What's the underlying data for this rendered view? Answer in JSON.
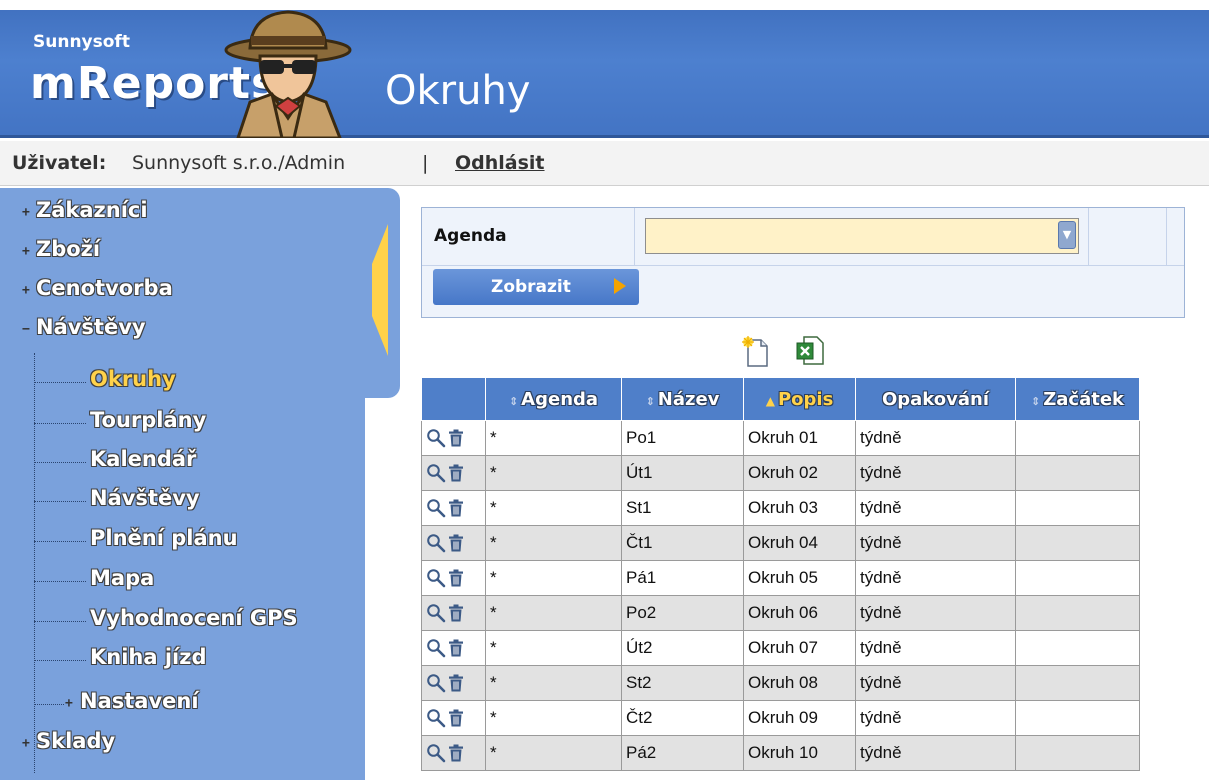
{
  "header": {
    "brand_small": "Sunnysoft",
    "brand_big": "mReports",
    "page_title": "Okruhy"
  },
  "userbar": {
    "user_label": "Uživatel:",
    "user_name": "Sunnysoft s.r.o./Admin",
    "separator": "|",
    "logout": "Odhlásit"
  },
  "sidebar": {
    "items": [
      {
        "label": "Zákazníci",
        "sign": "+"
      },
      {
        "label": "Zboží",
        "sign": "+"
      },
      {
        "label": "Cenotvorba",
        "sign": "+"
      },
      {
        "label": "Návštěvy",
        "sign": "−"
      }
    ],
    "subitems": [
      {
        "label": "Okruhy",
        "active": true
      },
      {
        "label": "Tourplány"
      },
      {
        "label": "Kalendář"
      },
      {
        "label": "Návštěvy"
      },
      {
        "label": "Plnění plánu"
      },
      {
        "label": "Mapa"
      },
      {
        "label": "Vyhodnocení GPS"
      },
      {
        "label": "Kniha jízd"
      },
      {
        "label": "Nastavení",
        "sign": "+"
      }
    ],
    "after_items": [
      {
        "label": "Sklady",
        "sign": "+"
      }
    ]
  },
  "filter": {
    "agenda_label": "Agenda",
    "agenda_value": "",
    "show_button": "Zobrazit"
  },
  "table": {
    "columns": [
      "Agenda",
      "Název",
      "Popis",
      "Opakování",
      "Začátek"
    ],
    "sorted_column": "Popis",
    "rows": [
      {
        "agenda": "*",
        "nazev": "Po1",
        "popis": "Okruh 01",
        "opakovani": "týdně",
        "zacatek": ""
      },
      {
        "agenda": "*",
        "nazev": "Út1",
        "popis": "Okruh 02",
        "opakovani": "týdně",
        "zacatek": ""
      },
      {
        "agenda": "*",
        "nazev": "St1",
        "popis": "Okruh 03",
        "opakovani": "týdně",
        "zacatek": ""
      },
      {
        "agenda": "*",
        "nazev": "Čt1",
        "popis": "Okruh 04",
        "opakovani": "týdně",
        "zacatek": ""
      },
      {
        "agenda": "*",
        "nazev": "Pá1",
        "popis": "Okruh 05",
        "opakovani": "týdně",
        "zacatek": ""
      },
      {
        "agenda": "*",
        "nazev": "Po2",
        "popis": "Okruh 06",
        "opakovani": "týdně",
        "zacatek": ""
      },
      {
        "agenda": "*",
        "nazev": "Út2",
        "popis": "Okruh 07",
        "opakovani": "týdně",
        "zacatek": ""
      },
      {
        "agenda": "*",
        "nazev": "St2",
        "popis": "Okruh 08",
        "opakovani": "týdně",
        "zacatek": ""
      },
      {
        "agenda": "*",
        "nazev": "Čt2",
        "popis": "Okruh 09",
        "opakovani": "týdně",
        "zacatek": ""
      },
      {
        "agenda": "*",
        "nazev": "Pá2",
        "popis": "Okruh 10",
        "opakovani": "týdně",
        "zacatek": ""
      }
    ]
  },
  "icons": {
    "detail": "magnifier-icon",
    "delete": "trash-icon",
    "new": "new-document-icon",
    "export": "excel-export-icon"
  },
  "colors": {
    "header_blue": "#4a7cc9",
    "sidebar_blue": "#7aa1dc",
    "active_yellow": "#ffd24a",
    "filter_input": "#fff2c8",
    "table_header": "#4f7fc9"
  }
}
